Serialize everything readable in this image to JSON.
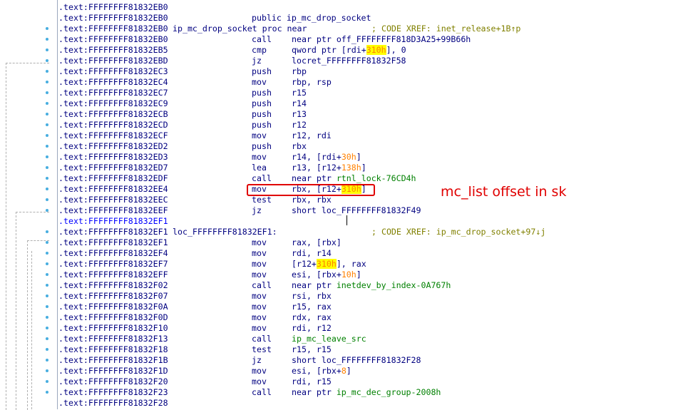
{
  "disassembly": {
    "lines": [
      {
        "addr": ".text:FFFFFFFF81832EB0",
        "label": "",
        "mn": "",
        "op": [],
        "cmt": ""
      },
      {
        "addr": ".text:FFFFFFFF81832EB0",
        "label": "",
        "mn": "",
        "op": [
          {
            "t": "public ip_mc_drop_socket"
          }
        ],
        "cmt": "",
        "opx": 271
      },
      {
        "addr": ".text:FFFFFFFF81832EB0",
        "label": "ip_mc_drop_socket proc near",
        "mn": "",
        "op": [],
        "cmt": "; CODE XREF: inet_release+1B↑p",
        "cmtx": 439
      },
      {
        "addr": ".text:FFFFFFFF81832EB0",
        "label": "",
        "mn": "call",
        "op": [
          {
            "t": "near ptr off_FFFFFFFF818D3A25+99B66h"
          }
        ],
        "cmt": ""
      },
      {
        "addr": ".text:FFFFFFFF81832EB5",
        "label": "",
        "mn": "cmp",
        "op": [
          {
            "t": "qword ptr [rdi+"
          },
          {
            "t": "310h",
            "c": "hl"
          },
          {
            "t": "], 0"
          }
        ],
        "cmt": ""
      },
      {
        "addr": ".text:FFFFFFFF81832EBD",
        "label": "",
        "mn": "jz",
        "op": [
          {
            "t": "locret_FFFFFFFF81832F58"
          }
        ],
        "cmt": ""
      },
      {
        "addr": ".text:FFFFFFFF81832EC3",
        "label": "",
        "mn": "push",
        "op": [
          {
            "t": "rbp"
          }
        ],
        "cmt": ""
      },
      {
        "addr": ".text:FFFFFFFF81832EC4",
        "label": "",
        "mn": "mov",
        "op": [
          {
            "t": "rbp, rsp"
          }
        ],
        "cmt": ""
      },
      {
        "addr": ".text:FFFFFFFF81832EC7",
        "label": "",
        "mn": "push",
        "op": [
          {
            "t": "r15"
          }
        ],
        "cmt": ""
      },
      {
        "addr": ".text:FFFFFFFF81832EC9",
        "label": "",
        "mn": "push",
        "op": [
          {
            "t": "r14"
          }
        ],
        "cmt": ""
      },
      {
        "addr": ".text:FFFFFFFF81832ECB",
        "label": "",
        "mn": "push",
        "op": [
          {
            "t": "r13"
          }
        ],
        "cmt": ""
      },
      {
        "addr": ".text:FFFFFFFF81832ECD",
        "label": "",
        "mn": "push",
        "op": [
          {
            "t": "r12"
          }
        ],
        "cmt": ""
      },
      {
        "addr": ".text:FFFFFFFF81832ECF",
        "label": "",
        "mn": "mov",
        "op": [
          {
            "t": "r12, rdi"
          }
        ],
        "cmt": ""
      },
      {
        "addr": ".text:FFFFFFFF81832ED2",
        "label": "",
        "mn": "push",
        "op": [
          {
            "t": "rbx"
          }
        ],
        "cmt": ""
      },
      {
        "addr": ".text:FFFFFFFF81832ED3",
        "label": "",
        "mn": "mov",
        "op": [
          {
            "t": "r14, [rdi+"
          },
          {
            "t": "30h",
            "c": "num"
          },
          {
            "t": "]"
          }
        ],
        "cmt": ""
      },
      {
        "addr": ".text:FFFFFFFF81832ED7",
        "label": "",
        "mn": "lea",
        "op": [
          {
            "t": "r13, [r12+"
          },
          {
            "t": "138h",
            "c": "num"
          },
          {
            "t": "]"
          }
        ],
        "cmt": ""
      },
      {
        "addr": ".text:FFFFFFFF81832EDF",
        "label": "",
        "mn": "call",
        "op": [
          {
            "t": "near ptr "
          },
          {
            "t": "rtnl_lock",
            "c": "name"
          },
          {
            "t": "-76CD4h",
            "c": "name"
          }
        ],
        "cmt": ""
      },
      {
        "addr": ".text:FFFFFFFF81832EE4",
        "label": "",
        "mn": "mov",
        "op": [
          {
            "t": "rbx, [r12+"
          },
          {
            "t": "310h",
            "c": "hl"
          },
          {
            "t": "]"
          }
        ],
        "cmt": ""
      },
      {
        "addr": ".text:FFFFFFFF81832EEC",
        "label": "",
        "mn": "test",
        "op": [
          {
            "t": "rbx, rbx"
          }
        ],
        "cmt": ""
      },
      {
        "addr": ".text:FFFFFFFF81832EEF",
        "label": "",
        "mn": "jz",
        "op": [
          {
            "t": "short loc_FFFFFFFF81832F49"
          }
        ],
        "cmt": ""
      },
      {
        "addr": ".text:FFFFFFFF81832EF1",
        "label": "",
        "mn": "",
        "op": [],
        "cmt": "",
        "cursor": true
      },
      {
        "addr": ".text:FFFFFFFF81832EF1",
        "label": "loc_FFFFFFFF81832EF1:",
        "mn": "",
        "op": [],
        "cmt": "; CODE XREF: ip_mc_drop_socket+97↓j",
        "cmtx": 439
      },
      {
        "addr": ".text:FFFFFFFF81832EF1",
        "label": "",
        "mn": "mov",
        "op": [
          {
            "t": "rax, [rbx]"
          }
        ],
        "cmt": ""
      },
      {
        "addr": ".text:FFFFFFFF81832EF4",
        "label": "",
        "mn": "mov",
        "op": [
          {
            "t": "rdi, r14"
          }
        ],
        "cmt": ""
      },
      {
        "addr": ".text:FFFFFFFF81832EF7",
        "label": "",
        "mn": "mov",
        "op": [
          {
            "t": "[r12+"
          },
          {
            "t": "310h",
            "c": "hl"
          },
          {
            "t": "], rax"
          }
        ],
        "cmt": ""
      },
      {
        "addr": ".text:FFFFFFFF81832EFF",
        "label": "",
        "mn": "mov",
        "op": [
          {
            "t": "esi, [rbx+"
          },
          {
            "t": "10h",
            "c": "num"
          },
          {
            "t": "]"
          }
        ],
        "cmt": ""
      },
      {
        "addr": ".text:FFFFFFFF81832F02",
        "label": "",
        "mn": "call",
        "op": [
          {
            "t": "near ptr "
          },
          {
            "t": "inetdev_by_index",
            "c": "name"
          },
          {
            "t": "-0A767h",
            "c": "name"
          }
        ],
        "cmt": ""
      },
      {
        "addr": ".text:FFFFFFFF81832F07",
        "label": "",
        "mn": "mov",
        "op": [
          {
            "t": "rsi, rbx"
          }
        ],
        "cmt": ""
      },
      {
        "addr": ".text:FFFFFFFF81832F0A",
        "label": "",
        "mn": "mov",
        "op": [
          {
            "t": "r15, rax"
          }
        ],
        "cmt": ""
      },
      {
        "addr": ".text:FFFFFFFF81832F0D",
        "label": "",
        "mn": "mov",
        "op": [
          {
            "t": "rdx, rax"
          }
        ],
        "cmt": ""
      },
      {
        "addr": ".text:FFFFFFFF81832F10",
        "label": "",
        "mn": "mov",
        "op": [
          {
            "t": "rdi, r12"
          }
        ],
        "cmt": ""
      },
      {
        "addr": ".text:FFFFFFFF81832F13",
        "label": "",
        "mn": "call",
        "op": [
          {
            "t": "ip_mc_leave_src",
            "c": "name"
          }
        ],
        "cmt": ""
      },
      {
        "addr": ".text:FFFFFFFF81832F18",
        "label": "",
        "mn": "test",
        "op": [
          {
            "t": "r15, r15"
          }
        ],
        "cmt": ""
      },
      {
        "addr": ".text:FFFFFFFF81832F1B",
        "label": "",
        "mn": "jz",
        "op": [
          {
            "t": "short loc_FFFFFFFF81832F28"
          }
        ],
        "cmt": ""
      },
      {
        "addr": ".text:FFFFFFFF81832F1D",
        "label": "",
        "mn": "mov",
        "op": [
          {
            "t": "esi, [rbx+"
          },
          {
            "t": "8",
            "c": "num"
          },
          {
            "t": "]"
          }
        ],
        "cmt": ""
      },
      {
        "addr": ".text:FFFFFFFF81832F20",
        "label": "",
        "mn": "mov",
        "op": [
          {
            "t": "rdi, r15"
          }
        ],
        "cmt": ""
      },
      {
        "addr": ".text:FFFFFFFF81832F23",
        "label": "",
        "mn": "call",
        "op": [
          {
            "t": "near ptr "
          },
          {
            "t": "ip_mc_dec_group",
            "c": "name"
          },
          {
            "t": "-2008h",
            "c": "name"
          }
        ],
        "cmt": ""
      },
      {
        "addr": ".text:FFFFFFFF81832F28",
        "label": "",
        "mn": "",
        "op": [],
        "cmt": ""
      }
    ]
  },
  "annotation": {
    "text": "mc_list offset in sk",
    "color": "#e00000"
  },
  "colors": {
    "address": "#000080",
    "highlight_bg": "#ffff00",
    "number": "#ff8000",
    "name": "#008000",
    "comment": "#808000",
    "breakpoint_dot": "#48aee0"
  }
}
